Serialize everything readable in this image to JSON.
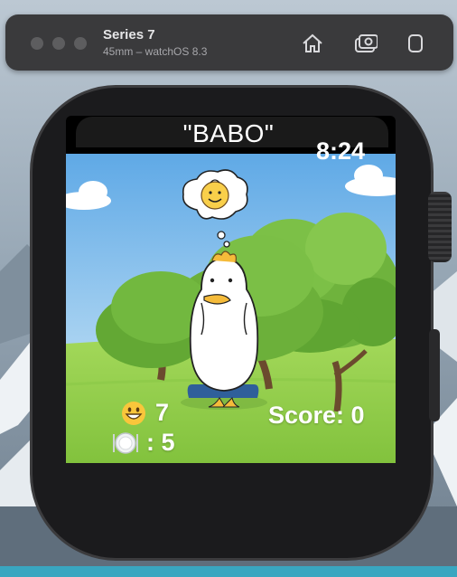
{
  "simulator": {
    "device_name": "Series 7",
    "device_info": "45mm – watchOS 8.3",
    "icons": [
      "home-icon",
      "screenshot-icon",
      "rotate-icon"
    ]
  },
  "watch": {
    "app_title": "\"BABO\"",
    "time": "8:24"
  },
  "game": {
    "mood_icon": "grinning-face-icon",
    "mood_value": "7",
    "food_icon": "plate-icon",
    "food_label": ": 5",
    "score_label": "Score: 0",
    "thought_bubble_icon": "duck-thought-icon"
  },
  "colors": {
    "sky_top": "#5fa9e6",
    "grass": "#97d24c",
    "duck_bill": "#f5bb3a",
    "pants": "#2f5f9a"
  }
}
